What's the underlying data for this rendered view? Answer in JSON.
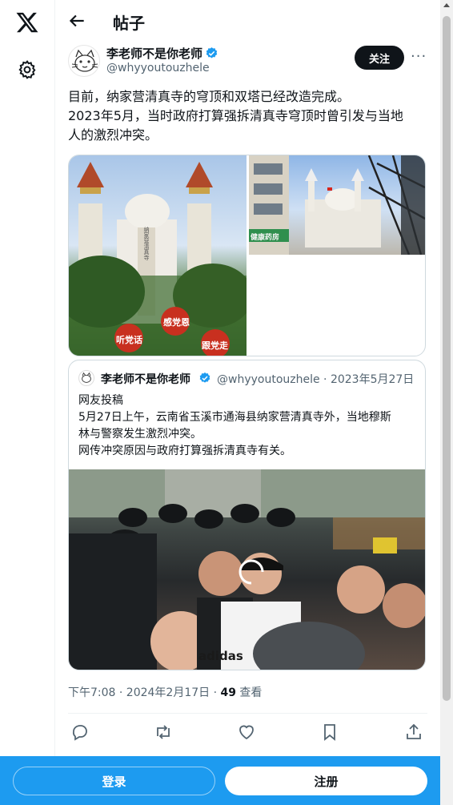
{
  "header": {
    "title": "帖子"
  },
  "nav": {
    "logo_icon": "x-logo-icon",
    "settings_icon": "gear-icon",
    "back_icon": "arrow-left-icon"
  },
  "post": {
    "author_name": "李老师不是你老师",
    "author_handle": "@whyyoutouzhele",
    "follow_label": "关注",
    "more_label": "···",
    "text_lines": [
      "目前，纳家营清真寺的穹顶和双塔已经改造完成。",
      "2023年5月，当时政府打算强拆清真寺穹顶时曾引发与当地",
      "人的激烈冲突。"
    ],
    "image1_signs": [
      "感党恩",
      "听党话",
      "跟党走"
    ],
    "image1_column_text": "纳家营清真寺",
    "image2_sign": "健康药房",
    "timestamp": "下午7:08 · 2024年2月17日 · ",
    "views_count": "49",
    "views_label": " 查看"
  },
  "quote": {
    "author_name": "李老师不是你老师",
    "handle_date": "@whyyoutouzhele · 2023年5月27日",
    "text_lines": [
      "网友投稿",
      "5月27日上午，云南省玉溪市通海县纳家营清真寺外，当地穆斯",
      "林与警察发生激烈冲突。",
      "网传冲突原因与政府打算强拆清真寺有关。"
    ],
    "video_shirt_text": "adidas"
  },
  "actions": [
    "reply-icon",
    "repost-icon",
    "like-icon",
    "bookmark-icon",
    "share-icon"
  ],
  "bottom_bar": {
    "login_label": "登录",
    "signup_label": "注册"
  },
  "colors": {
    "accent": "#1d9bf0",
    "text": "#0f1419",
    "muted": "#536471",
    "border": "#cfd9de"
  }
}
